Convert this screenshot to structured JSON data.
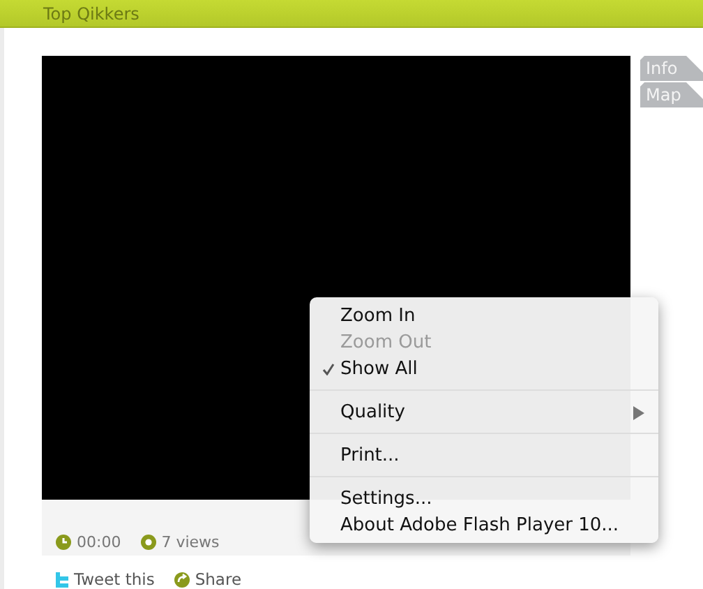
{
  "header": {
    "title": "Top Qikkers"
  },
  "side_tabs": [
    {
      "label": "Info"
    },
    {
      "label": "Map"
    }
  ],
  "video": {
    "duration": "00:00",
    "views": "7 views"
  },
  "share": [
    {
      "kind": "tweet",
      "label": "Tweet this"
    },
    {
      "kind": "share",
      "label": "Share"
    }
  ],
  "context_menu": [
    {
      "kind": "item",
      "label": "Zoom In",
      "disabled": false,
      "checked": false
    },
    {
      "kind": "item",
      "label": "Zoom Out",
      "disabled": true,
      "checked": false
    },
    {
      "kind": "item",
      "label": "Show All",
      "disabled": false,
      "checked": true
    },
    {
      "kind": "separator"
    },
    {
      "kind": "submenu",
      "label": "Quality",
      "disabled": false,
      "checked": false
    },
    {
      "kind": "separator"
    },
    {
      "kind": "item",
      "label": "Print...",
      "disabled": false,
      "checked": false
    },
    {
      "kind": "separator"
    },
    {
      "kind": "item",
      "label": "Settings...",
      "disabled": false,
      "checked": false
    },
    {
      "kind": "item",
      "label": "About Adobe Flash Player 10...",
      "disabled": false,
      "checked": false
    }
  ]
}
